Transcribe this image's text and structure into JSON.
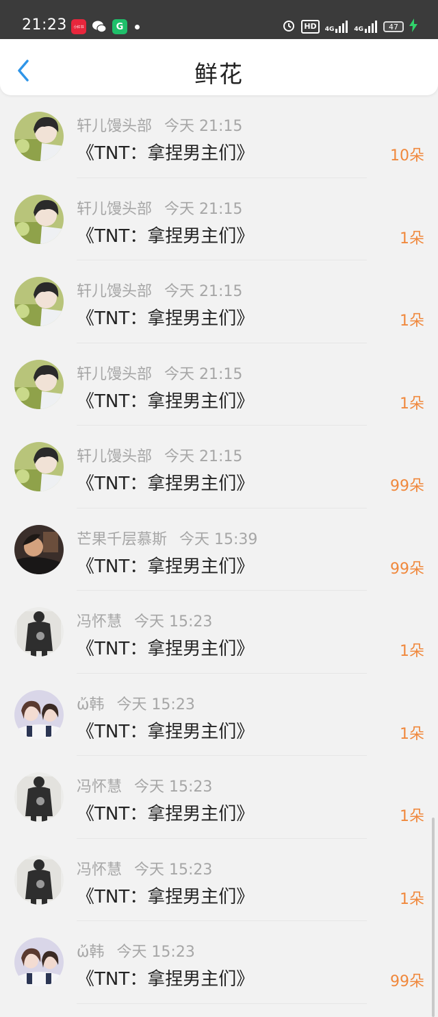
{
  "status_bar": {
    "time": "21:23",
    "app_red_label": "小红书",
    "app_green_label": "G",
    "hd": "HD",
    "net1": "4G",
    "net2": "4G",
    "battery": "47"
  },
  "header": {
    "title": "鲜花"
  },
  "items": [
    {
      "nick": "轩儿馒头部",
      "time": "今天 21:15",
      "book": "《TNT：拿捏男主们》",
      "count": "10朵",
      "avatar": "a1"
    },
    {
      "nick": "轩儿馒头部",
      "time": "今天 21:15",
      "book": "《TNT：拿捏男主们》",
      "count": "1朵",
      "avatar": "a1"
    },
    {
      "nick": "轩儿馒头部",
      "time": "今天 21:15",
      "book": "《TNT：拿捏男主们》",
      "count": "1朵",
      "avatar": "a1"
    },
    {
      "nick": "轩儿馒头部",
      "time": "今天 21:15",
      "book": "《TNT：拿捏男主们》",
      "count": "1朵",
      "avatar": "a1"
    },
    {
      "nick": "轩儿馒头部",
      "time": "今天 21:15",
      "book": "《TNT：拿捏男主们》",
      "count": "99朵",
      "avatar": "a1"
    },
    {
      "nick": "芒果千层慕斯",
      "time": "今天 15:39",
      "book": "《TNT：拿捏男主们》",
      "count": "99朵",
      "avatar": "a2"
    },
    {
      "nick": "冯怀慧",
      "time": "今天 15:23",
      "book": "《TNT：拿捏男主们》",
      "count": "1朵",
      "avatar": "a3"
    },
    {
      "nick": "ὤ韩",
      "time": "今天 15:23",
      "book": "《TNT：拿捏男主们》",
      "count": "1朵",
      "avatar": "a4"
    },
    {
      "nick": "冯怀慧",
      "time": "今天 15:23",
      "book": "《TNT：拿捏男主们》",
      "count": "1朵",
      "avatar": "a3"
    },
    {
      "nick": "冯怀慧",
      "time": "今天 15:23",
      "book": "《TNT：拿捏男主们》",
      "count": "1朵",
      "avatar": "a3"
    },
    {
      "nick": "ὤ韩",
      "time": "今天 15:23",
      "book": "《TNT：拿捏男主们》",
      "count": "99朵",
      "avatar": "a4"
    }
  ],
  "colors": {
    "accent": "#f0883c",
    "back": "#2f95e8"
  }
}
